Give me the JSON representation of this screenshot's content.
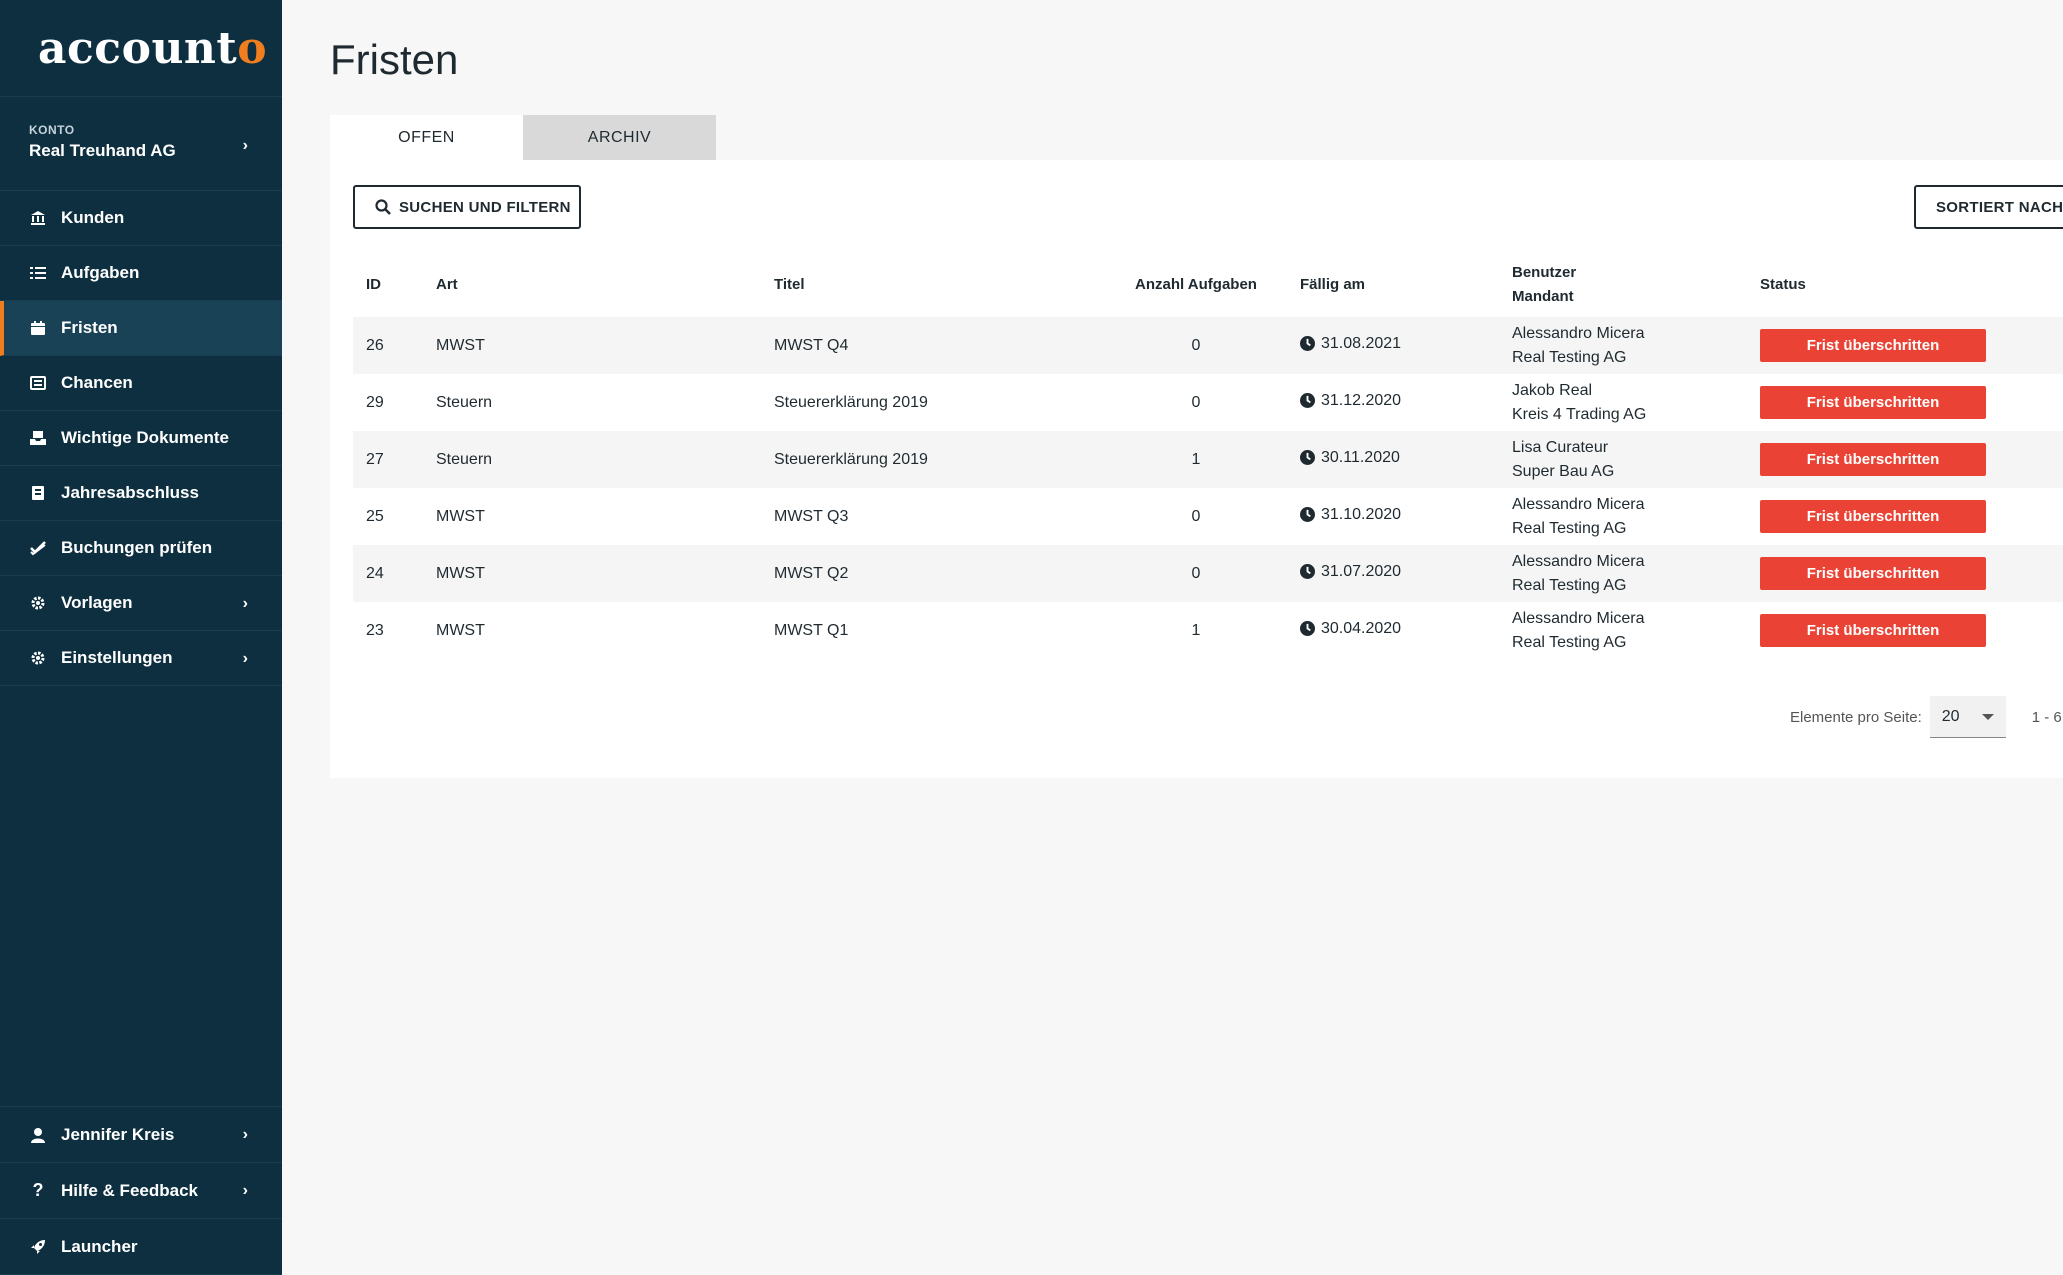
{
  "logo": {
    "text_main": "account",
    "text_accent": "o"
  },
  "account": {
    "label": "KONTO",
    "name": "Real Treuhand AG"
  },
  "nav": [
    {
      "label": "Kunden",
      "icon": "bank-icon"
    },
    {
      "label": "Aufgaben",
      "icon": "list-icon"
    },
    {
      "label": "Fristen",
      "icon": "calendar-icon",
      "active": true
    },
    {
      "label": "Chancen",
      "icon": "newspaper-icon"
    },
    {
      "label": "Wichtige Dokumente",
      "icon": "inbox-icon"
    },
    {
      "label": "Jahresabschluss",
      "icon": "book-icon"
    },
    {
      "label": "Buchungen prüfen",
      "icon": "check-double-icon"
    },
    {
      "label": "Vorlagen",
      "icon": "gear-icon"
    },
    {
      "label": "Einstellungen",
      "icon": "gear-icon"
    }
  ],
  "bottom_nav": [
    {
      "label": "Jennifer Kreis",
      "icon": "user-icon"
    },
    {
      "label": "Hilfe & Feedback",
      "icon": "question-icon"
    },
    {
      "label": "Launcher",
      "icon": "rocket-icon"
    }
  ],
  "page": {
    "title": "Fristen"
  },
  "tabs": [
    {
      "label": "OFFEN",
      "active": true
    },
    {
      "label": "ARCHIV",
      "active": false
    }
  ],
  "toolbar": {
    "search_label": "SUCHEN UND FILTERN",
    "sort_label": "SORTIERT NACH F"
  },
  "table": {
    "headers": {
      "id": "ID",
      "art": "Art",
      "titel": "Titel",
      "anzahl": "Anzahl Aufgaben",
      "faellig": "Fällig am",
      "benutzer": "Benutzer",
      "mandant": "Mandant",
      "status": "Status"
    },
    "rows": [
      {
        "id": "26",
        "art": "MWST",
        "titel": "MWST Q4",
        "anzahl": "0",
        "faellig": "31.08.2021",
        "benutzer": "Alessandro Micera",
        "mandant": "Real Testing AG",
        "status": "Frist überschritten"
      },
      {
        "id": "29",
        "art": "Steuern",
        "titel": "Steuererklärung 2019",
        "anzahl": "0",
        "faellig": "31.12.2020",
        "benutzer": "Jakob Real",
        "mandant": "Kreis 4 Trading AG",
        "status": "Frist überschritten"
      },
      {
        "id": "27",
        "art": "Steuern",
        "titel": "Steuererklärung 2019",
        "anzahl": "1",
        "faellig": "30.11.2020",
        "benutzer": "Lisa Curateur",
        "mandant": "Super Bau AG",
        "status": "Frist überschritten"
      },
      {
        "id": "25",
        "art": "MWST",
        "titel": "MWST Q3",
        "anzahl": "0",
        "faellig": "31.10.2020",
        "benutzer": "Alessandro Micera",
        "mandant": "Real Testing AG",
        "status": "Frist überschritten"
      },
      {
        "id": "24",
        "art": "MWST",
        "titel": "MWST Q2",
        "anzahl": "0",
        "faellig": "31.07.2020",
        "benutzer": "Alessandro Micera",
        "mandant": "Real Testing AG",
        "status": "Frist überschritten"
      },
      {
        "id": "23",
        "art": "MWST",
        "titel": "MWST Q1",
        "anzahl": "1",
        "faellig": "30.04.2020",
        "benutzer": "Alessandro Micera",
        "mandant": "Real Testing AG",
        "status": "Frist überschritten"
      }
    ]
  },
  "pagination": {
    "label": "Elemente pro Seite:",
    "per_page": "20",
    "range": "1 - 6"
  },
  "colors": {
    "sidebar": "#0d2f40",
    "accent": "#f07d1e",
    "status_overdue": "#ea4335"
  }
}
